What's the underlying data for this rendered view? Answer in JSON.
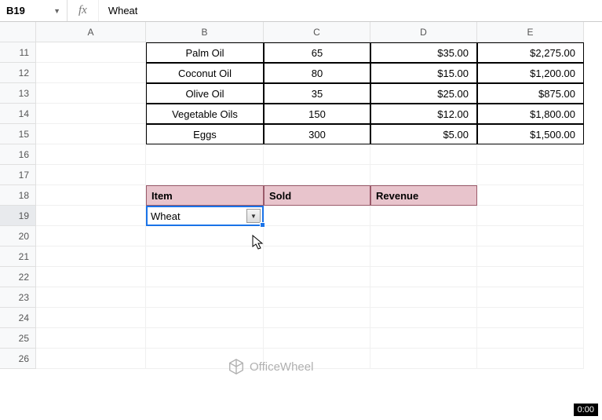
{
  "nameBox": "B19",
  "fxLabel": "fx",
  "formula": "Wheat",
  "columns": [
    "A",
    "B",
    "C",
    "D",
    "E"
  ],
  "rows": [
    "11",
    "12",
    "13",
    "14",
    "15",
    "16",
    "17",
    "18",
    "19",
    "20",
    "21",
    "22",
    "23",
    "24",
    "25",
    "26"
  ],
  "data": {
    "r11": {
      "b": "Palm Oil",
      "c": "65",
      "d": "$35.00",
      "e": "$2,275.00"
    },
    "r12": {
      "b": "Coconut Oil",
      "c": "80",
      "d": "$15.00",
      "e": "$1,200.00"
    },
    "r13": {
      "b": "Olive Oil",
      "c": "35",
      "d": "$25.00",
      "e": "$875.00"
    },
    "r14": {
      "b": "Vegetable Oils",
      "c": "150",
      "d": "$12.00",
      "e": "$1,800.00"
    },
    "r15": {
      "b": "Eggs",
      "c": "300",
      "d": "$5.00",
      "e": "$1,500.00"
    }
  },
  "headers": {
    "item": "Item",
    "sold": "Sold",
    "revenue": "Revenue"
  },
  "dropdown": {
    "value": "Wheat"
  },
  "watermark": "OfficeWheel",
  "videoTime": "0:00"
}
